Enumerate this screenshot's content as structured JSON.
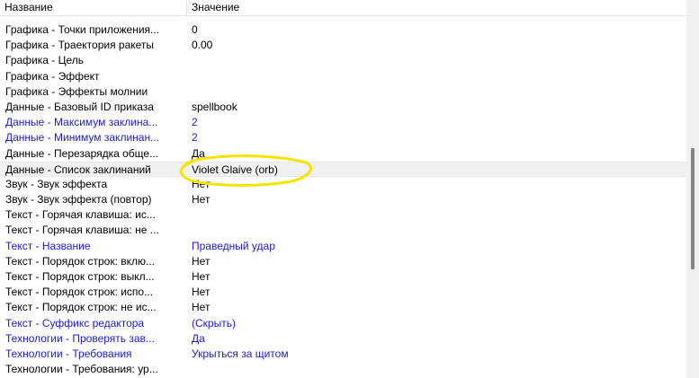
{
  "columns": {
    "name": "Название",
    "value": "Значение"
  },
  "colors": {
    "modified_text": "#1c1cc4",
    "annotation": "#f5e400",
    "selected_row_bg": "#f0f0f0"
  },
  "rows": [
    {
      "name": "Графика - Точки приложения...",
      "value": "0",
      "modified": false
    },
    {
      "name": "Графика - Траектория ракеты",
      "value": "0.00",
      "modified": false
    },
    {
      "name": "Графика - Цель",
      "value": "",
      "modified": false
    },
    {
      "name": "Графика - Эффект",
      "value": "",
      "modified": false
    },
    {
      "name": "Графика - Эффекты молнии",
      "value": "",
      "modified": false
    },
    {
      "name": "Данные - Базовый ID приказа",
      "value": "spellbook",
      "modified": false
    },
    {
      "name": "Данные - Максимум заклина...",
      "value": "2",
      "modified": true
    },
    {
      "name": "Данные - Минимум заклинан...",
      "value": "2",
      "modified": true
    },
    {
      "name": "Данные - Перезарядка обще...",
      "value": "Да",
      "modified": false
    },
    {
      "name": "Данные - Список заклинаний",
      "value": "Violet Glaive (orb)",
      "modified": false,
      "selected": true
    },
    {
      "name": "Звук - Звук эффекта",
      "value": "Нет",
      "modified": false
    },
    {
      "name": "Звук - Звук эффекта (повтор)",
      "value": "Нет",
      "modified": false
    },
    {
      "name": "Текст - Горячая клавиша: ис...",
      "value": "",
      "modified": false
    },
    {
      "name": "Текст - Горячая клавиша: не ...",
      "value": "",
      "modified": false
    },
    {
      "name": "Текст - Название",
      "value": "Праведный удар",
      "modified": true
    },
    {
      "name": "Текст - Порядок строк: вклю...",
      "value": "Нет",
      "modified": false
    },
    {
      "name": "Текст - Порядок строк: выкл...",
      "value": "Нет",
      "modified": false
    },
    {
      "name": "Текст - Порядок строк: испо...",
      "value": "Нет",
      "modified": false
    },
    {
      "name": "Текст - Порядок строк: не ис...",
      "value": "Нет",
      "modified": false
    },
    {
      "name": "Текст - Суффикс редактора",
      "value": "(Скрыть)",
      "modified": true
    },
    {
      "name": "Технологии - Проверять зав...",
      "value": "Да",
      "modified": true
    },
    {
      "name": "Технологии - Требования",
      "value": "Укрыться за щитом",
      "modified": true
    },
    {
      "name": "Технологии - Требования: ур...",
      "value": "",
      "modified": false
    }
  ]
}
